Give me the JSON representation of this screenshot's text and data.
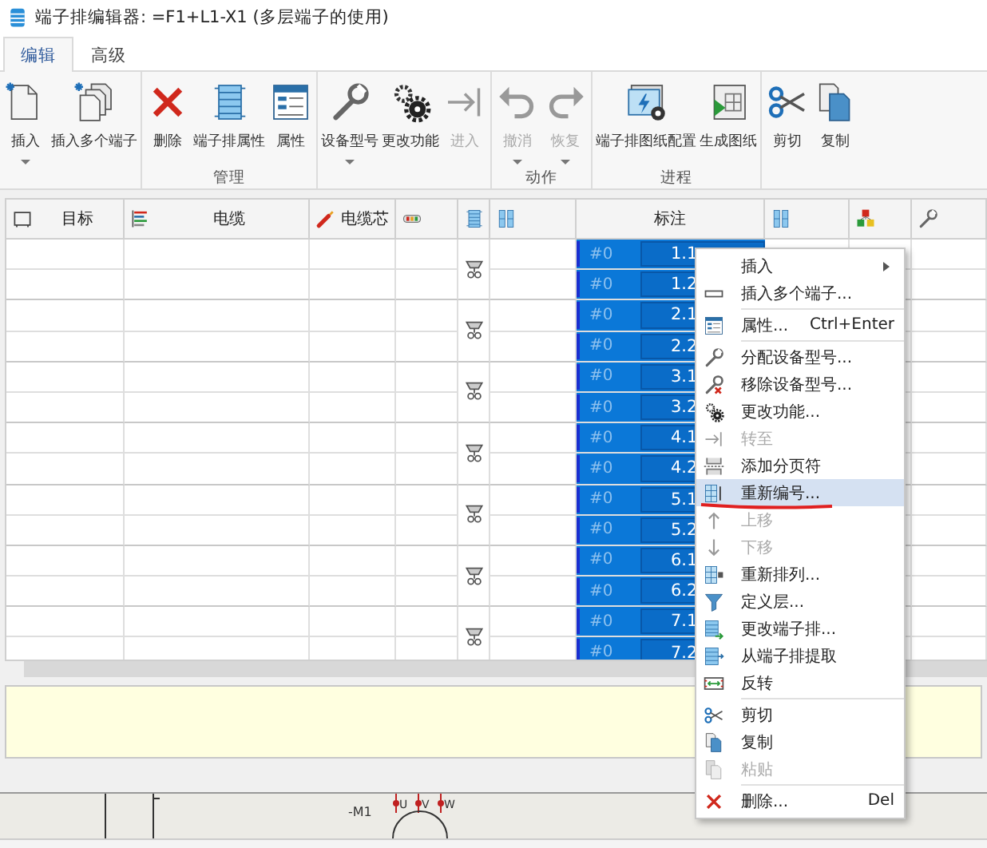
{
  "window": {
    "title": "端子排编辑器: =F1+L1-X1 (多层端子的使用)"
  },
  "tabs": [
    {
      "label": "编辑",
      "selected": true
    },
    {
      "label": "高级",
      "selected": false
    }
  ],
  "ribbon": {
    "groups": [
      {
        "buttons": [
          {
            "label": "插入",
            "dropdown": true,
            "disabled": false
          },
          {
            "label": "插入多个端子",
            "dropdown": false,
            "disabled": false
          }
        ]
      },
      {
        "label": "管理",
        "buttons": [
          {
            "label": "删除",
            "dropdown": false,
            "disabled": false
          },
          {
            "label": "端子排属性",
            "dropdown": false,
            "disabled": false
          },
          {
            "label": "属性",
            "dropdown": false,
            "disabled": false
          }
        ]
      },
      {
        "buttons": [
          {
            "label": "设备型号",
            "dropdown": true,
            "disabled": false
          },
          {
            "label": "更改功能",
            "dropdown": false,
            "disabled": false
          },
          {
            "label": "进入",
            "dropdown": false,
            "disabled": true
          }
        ]
      },
      {
        "label": "动作",
        "buttons": [
          {
            "label": "撤消",
            "dropdown": true,
            "disabled": true
          },
          {
            "label": "恢复",
            "dropdown": true,
            "disabled": true
          }
        ]
      },
      {
        "label": "进程",
        "buttons": [
          {
            "label": "端子排图纸配置",
            "dropdown": false,
            "disabled": false
          },
          {
            "label": "生成图纸",
            "dropdown": false,
            "disabled": false
          }
        ]
      },
      {
        "buttons": [
          {
            "label": "剪切",
            "dropdown": false,
            "disabled": false
          },
          {
            "label": "复制",
            "dropdown": false,
            "disabled": false
          }
        ]
      }
    ]
  },
  "table": {
    "columns": [
      {
        "label": "目标"
      },
      {
        "label": "电缆"
      },
      {
        "label": "电缆芯"
      },
      {},
      {},
      {},
      {
        "label": "标注"
      },
      {},
      {},
      {}
    ],
    "terminals": [
      {
        "levels": [
          {
            "layer": "#0",
            "marking": "1.1",
            "selected": true
          },
          {
            "layer": "#0",
            "marking": "1.2",
            "selected": true
          }
        ]
      },
      {
        "levels": [
          {
            "layer": "#0",
            "marking": "2.1",
            "selected": true
          },
          {
            "layer": "#0",
            "marking": "2.2",
            "selected": true
          }
        ]
      },
      {
        "levels": [
          {
            "layer": "#0",
            "marking": "3.1",
            "selected": true
          },
          {
            "layer": "#0",
            "marking": "3.2",
            "selected": true
          }
        ]
      },
      {
        "levels": [
          {
            "layer": "#0",
            "marking": "4.1",
            "selected": true
          },
          {
            "layer": "#0",
            "marking": "4.2",
            "selected": true
          }
        ]
      },
      {
        "levels": [
          {
            "layer": "#0",
            "marking": "5.1",
            "selected": true
          },
          {
            "layer": "#0",
            "marking": "5.2",
            "selected": true
          }
        ]
      },
      {
        "levels": [
          {
            "layer": "#0",
            "marking": "6.1",
            "selected": true
          },
          {
            "layer": "#0",
            "marking": "6.2",
            "selected": true
          }
        ]
      },
      {
        "levels": [
          {
            "layer": "#0",
            "marking": "7.1",
            "selected": true
          },
          {
            "layer": "#0",
            "marking": "7.2",
            "selected": true
          }
        ]
      }
    ]
  },
  "context_menu": {
    "items": [
      {
        "kind": "item",
        "label": "插入",
        "submenu": true,
        "disabled": false,
        "selected": false
      },
      {
        "kind": "item",
        "label": "插入多个端子...",
        "disabled": false,
        "selected": false
      },
      {
        "kind": "separator"
      },
      {
        "kind": "item",
        "label": "属性...",
        "shortcut": "Ctrl+Enter",
        "disabled": false,
        "selected": false
      },
      {
        "kind": "separator"
      },
      {
        "kind": "item",
        "label": "分配设备型号...",
        "disabled": false,
        "selected": false
      },
      {
        "kind": "item",
        "label": "移除设备型号...",
        "disabled": false,
        "selected": false
      },
      {
        "kind": "item",
        "label": "更改功能...",
        "disabled": false,
        "selected": false
      },
      {
        "kind": "item",
        "label": "转至",
        "disabled": true,
        "selected": false
      },
      {
        "kind": "item",
        "label": "添加分页符",
        "disabled": false,
        "selected": false
      },
      {
        "kind": "item",
        "label": "重新编号...",
        "disabled": false,
        "selected": true,
        "underlined": true
      },
      {
        "kind": "item",
        "label": "上移",
        "disabled": true,
        "selected": false
      },
      {
        "kind": "item",
        "label": "下移",
        "disabled": true,
        "selected": false
      },
      {
        "kind": "item",
        "label": "重新排列...",
        "disabled": false,
        "selected": false
      },
      {
        "kind": "item",
        "label": "定义层...",
        "disabled": false,
        "selected": false
      },
      {
        "kind": "item",
        "label": "更改端子排...",
        "disabled": false,
        "selected": false
      },
      {
        "kind": "item",
        "label": "从端子排提取",
        "disabled": false,
        "selected": false
      },
      {
        "kind": "item",
        "label": "反转",
        "disabled": false,
        "selected": false
      },
      {
        "kind": "separator"
      },
      {
        "kind": "item",
        "label": "剪切",
        "disabled": false,
        "selected": false
      },
      {
        "kind": "item",
        "label": "复制",
        "disabled": false,
        "selected": false
      },
      {
        "kind": "item",
        "label": "粘贴",
        "disabled": true,
        "selected": false
      },
      {
        "kind": "separator"
      },
      {
        "kind": "item",
        "label": "删除...",
        "shortcut": "Del",
        "disabled": false,
        "selected": false
      }
    ]
  },
  "schematic": {
    "device": "-M1",
    "pins": [
      "U",
      "V",
      "W"
    ]
  }
}
